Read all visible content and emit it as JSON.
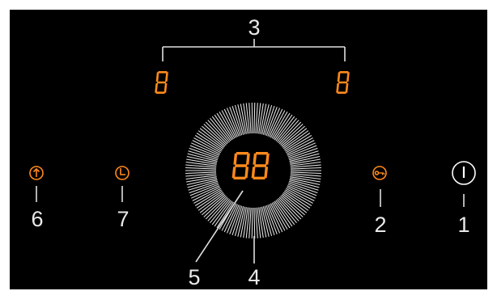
{
  "callouts": {
    "label_1": "1",
    "label_2": "2",
    "label_3": "3",
    "label_4": "4",
    "label_5": "5",
    "label_6": "6",
    "label_7": "7"
  },
  "displays": {
    "left_zone": "8",
    "right_zone": "8",
    "center": "88"
  },
  "colors": {
    "panel": "#000000",
    "accent": "#ff8a1c",
    "line": "#e0e0e0",
    "power_icon": "#ffffff"
  },
  "icons": {
    "boost": "arrow-up-circle-icon",
    "timer": "clock-icon",
    "lock": "key-icon",
    "power": "power-icon"
  },
  "slider": {
    "tick_count": 150
  }
}
